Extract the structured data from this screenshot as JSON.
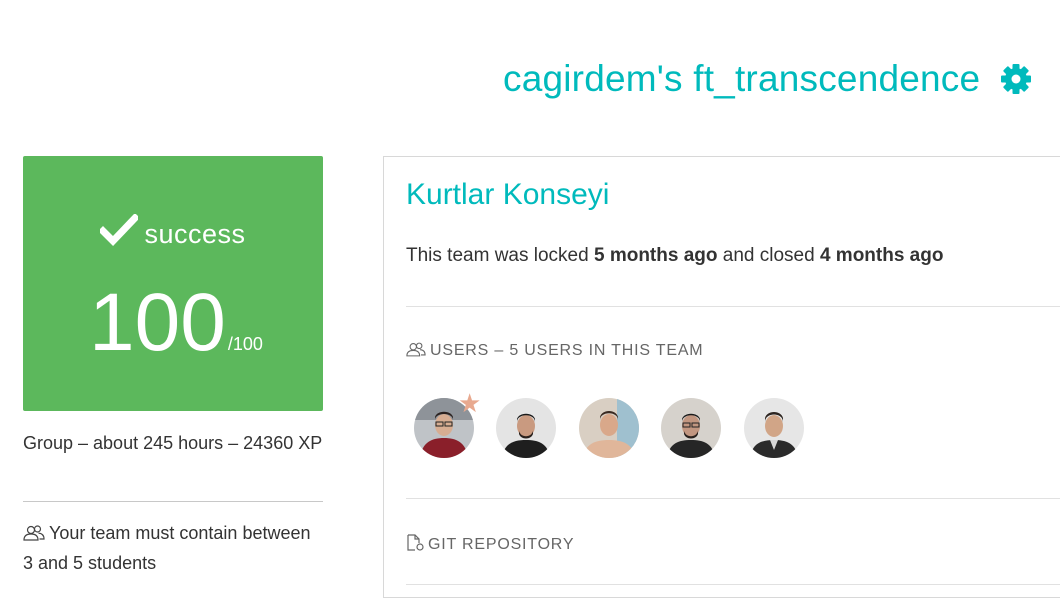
{
  "header": {
    "project_title": "cagirdem's ft_transcendence",
    "settings_icon": "gear-icon",
    "accent_color": "#00babc"
  },
  "score": {
    "status_icon": "checkmark-icon",
    "status": "success",
    "value": "100",
    "max": "/100",
    "color": "#5cb85c"
  },
  "sidebar": {
    "group_info": "Group – about 245 hours – 24360 XP",
    "team_size_icon": "users-icon",
    "team_size": "Your team must contain between 3 and 5 students"
  },
  "team": {
    "name": "Kurtlar Konseyi",
    "status_prefix": "This team was locked ",
    "locked_ago": "5 months ago",
    "status_middle": " and closed ",
    "closed_ago": "4 months ago"
  },
  "users_section": {
    "icon": "users-icon",
    "heading": "Users – 5 users in this team",
    "leader_icon": "star-icon",
    "users": [
      {
        "avatar": "user-avatar",
        "leader": true
      },
      {
        "avatar": "user-avatar",
        "leader": false
      },
      {
        "avatar": "user-avatar",
        "leader": false
      },
      {
        "avatar": "user-avatar",
        "leader": false
      },
      {
        "avatar": "user-avatar",
        "leader": false
      }
    ]
  },
  "git_section": {
    "icon": "file-icon",
    "heading": "Git repository"
  }
}
